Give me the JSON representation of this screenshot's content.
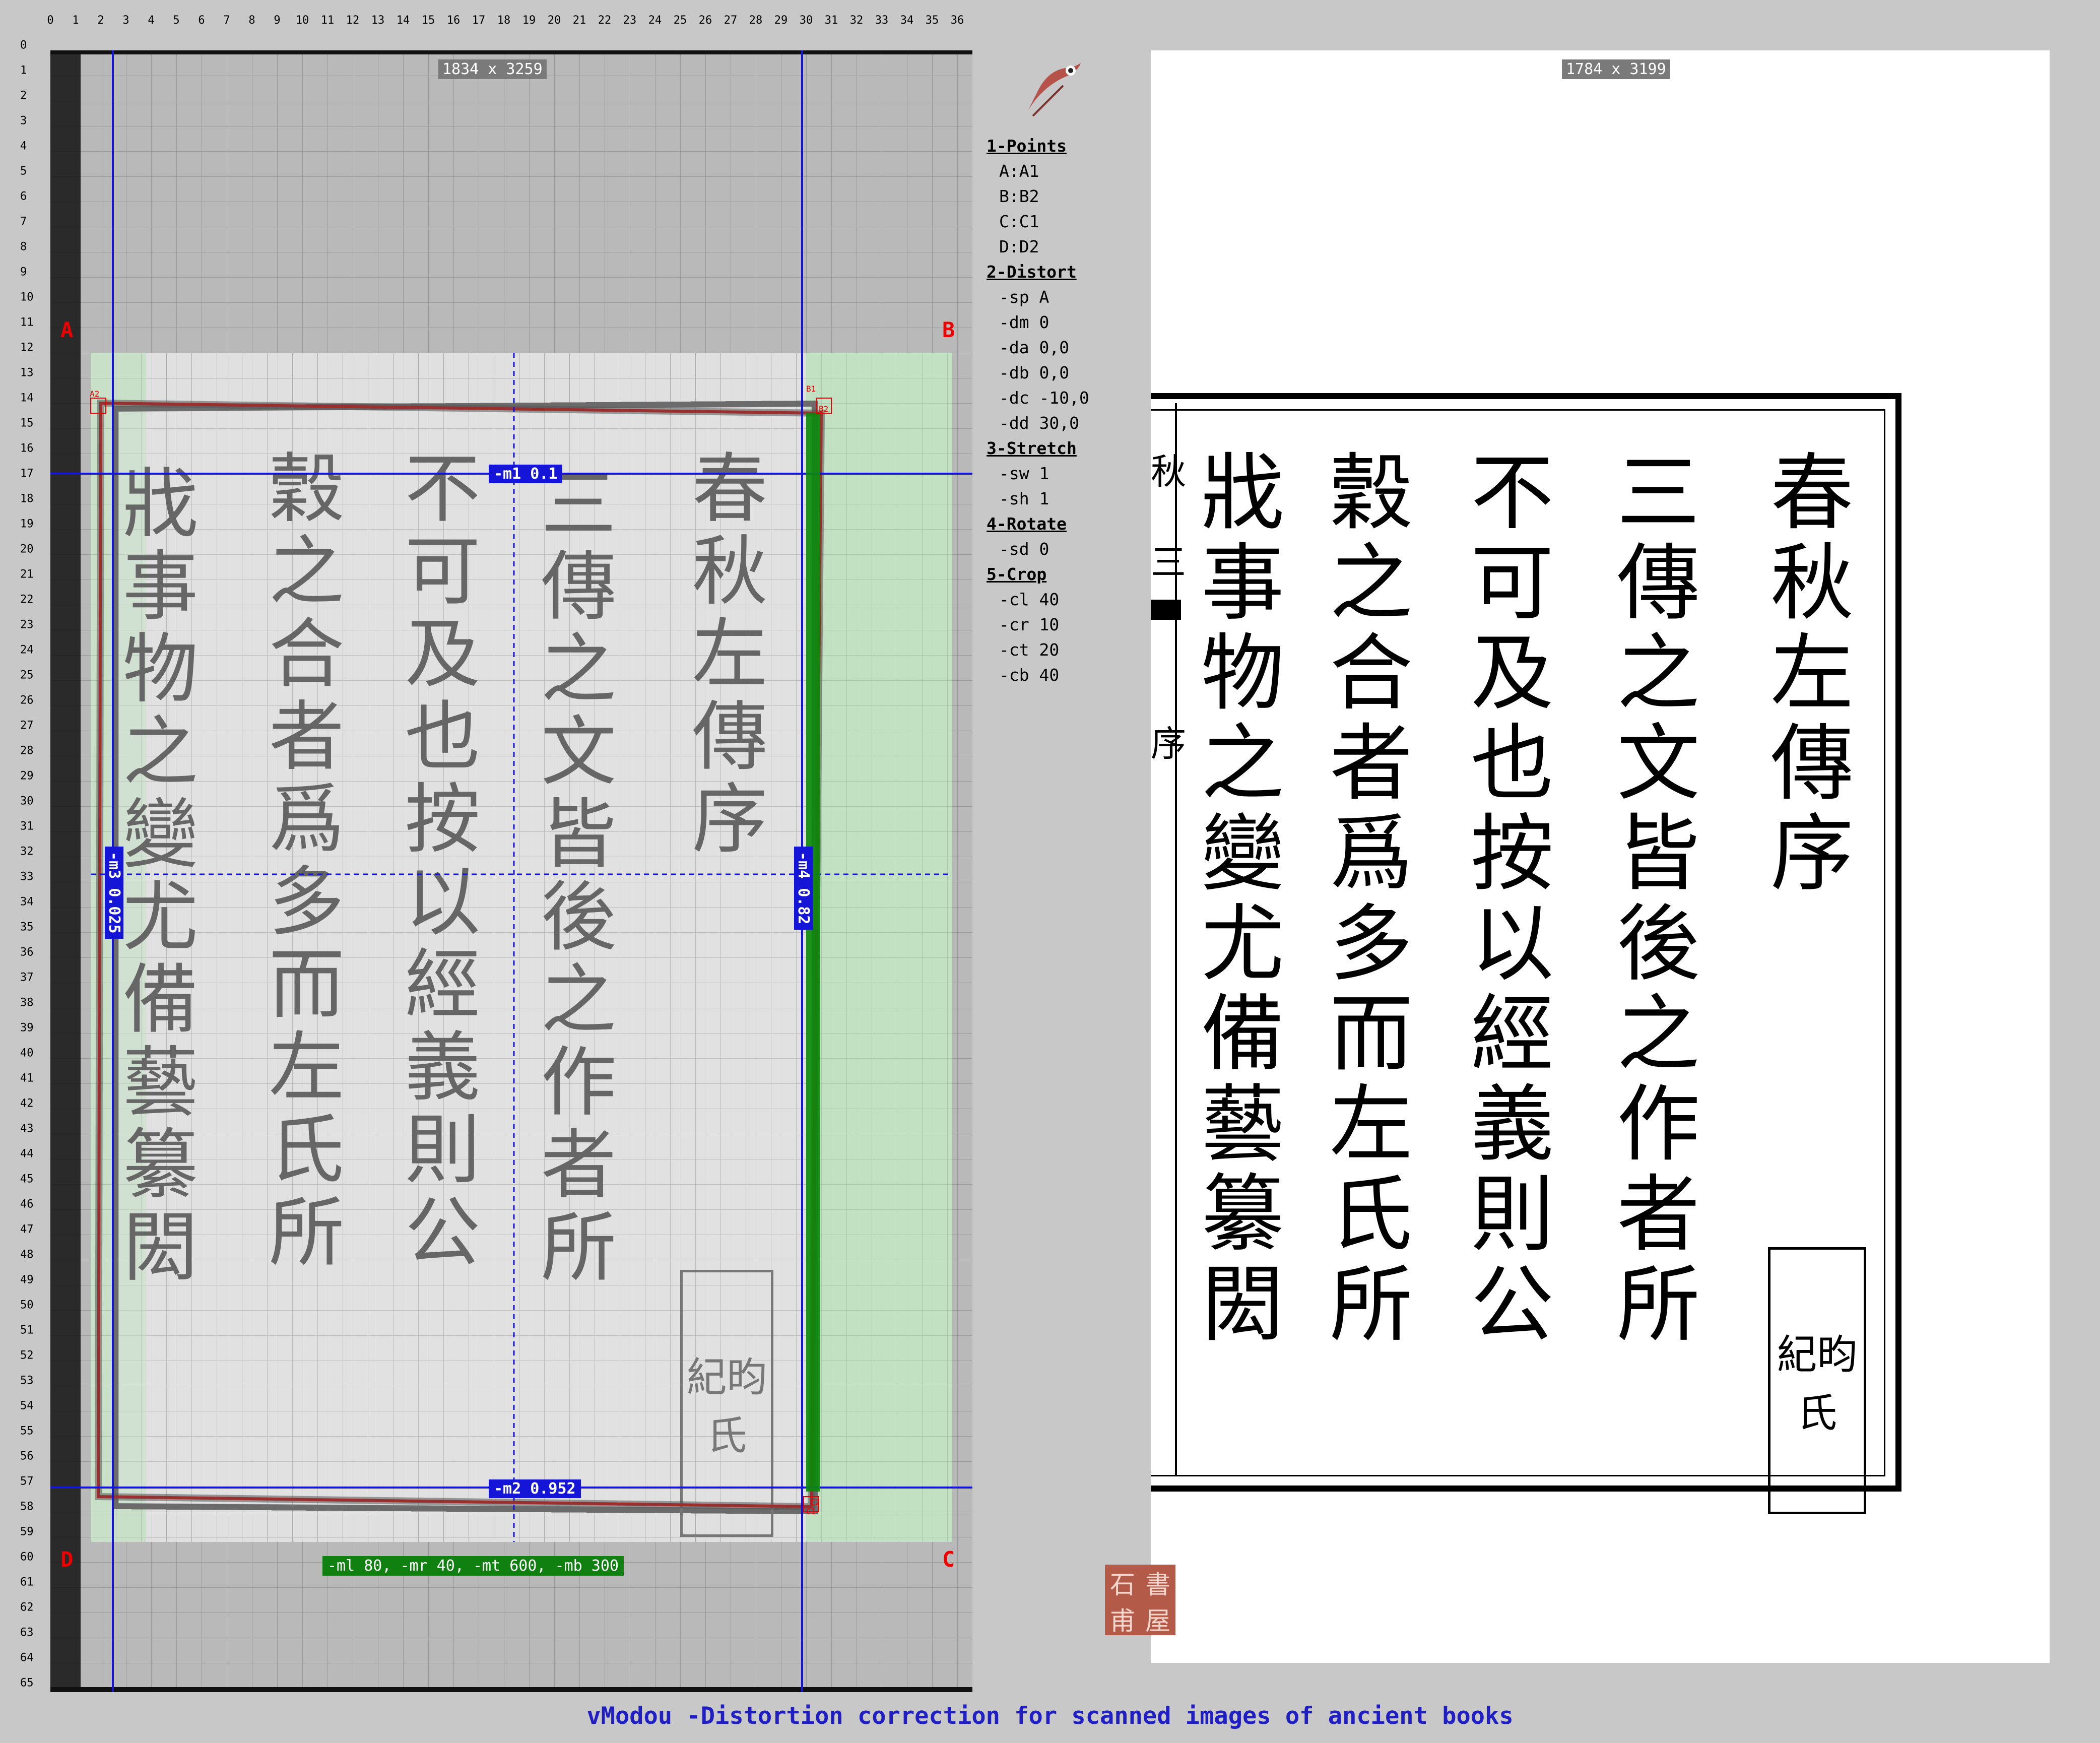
{
  "app": {
    "footer_title": "vModou -Distortion correction for scanned images of ancient books"
  },
  "ruler": {
    "top": [
      "0",
      "1",
      "2",
      "3",
      "4",
      "5",
      "6",
      "7",
      "8",
      "9",
      "10",
      "11",
      "12",
      "13",
      "14",
      "15",
      "16",
      "17",
      "18",
      "19",
      "20",
      "21",
      "22",
      "23",
      "24",
      "25",
      "26",
      "27",
      "28",
      "29",
      "30",
      "31",
      "32",
      "33",
      "34",
      "35",
      "36"
    ],
    "left": [
      "0",
      "1",
      "2",
      "3",
      "4",
      "5",
      "6",
      "7",
      "8",
      "9",
      "10",
      "11",
      "12",
      "13",
      "14",
      "15",
      "16",
      "17",
      "18",
      "19",
      "20",
      "21",
      "22",
      "23",
      "24",
      "25",
      "26",
      "27",
      "28",
      "29",
      "30",
      "31",
      "32",
      "33",
      "34",
      "35",
      "36",
      "37",
      "38",
      "39",
      "40",
      "41",
      "42",
      "43",
      "44",
      "45",
      "46",
      "47",
      "48",
      "49",
      "50",
      "51",
      "52",
      "53",
      "54",
      "55",
      "56",
      "57",
      "58",
      "59",
      "60",
      "61",
      "62",
      "63",
      "64",
      "65"
    ]
  },
  "left_panel": {
    "dimensions": "1834 x 3259",
    "corners": {
      "a": "A",
      "b": "B",
      "c": "C",
      "d": "D"
    },
    "point_labels": {
      "a1": "A1",
      "a2": "A2",
      "b1": "B1",
      "b2": "B2",
      "c1": "C1",
      "c2": "C2"
    },
    "guides": {
      "m1": "-m1 0.1",
      "m2": "-m2 0.952",
      "m3": "-m3 0.025",
      "m4": "-m4 0.82"
    },
    "margins": "-ml 80, -mr 40, -mt 600, -mb 300"
  },
  "text_columns": [
    "春秋左傳序",
    "三傳之文皆後之作者所",
    "不可及也按以經義則公",
    "穀之合者爲多而左氏所",
    "戕事物之變尤備藝纂閎"
  ],
  "seal_text": [
    "紀",
    "昀",
    "氏"
  ],
  "sidebar": {
    "sections": [
      {
        "title": "1-Points",
        "items": [
          "A:A1",
          "B:B2",
          "C:C1",
          "D:D2"
        ]
      },
      {
        "title": "2-Distort",
        "items": [
          "-sp A",
          "-dm 0",
          "-da 0,0",
          "-db 0,0",
          "-dc -10,0",
          "-dd 30,0"
        ]
      },
      {
        "title": "3-Stretch",
        "items": [
          "-sw 1",
          "-sh 1"
        ]
      },
      {
        "title": "4-Rotate",
        "items": [
          "-sd 0"
        ]
      },
      {
        "title": "5-Crop",
        "items": [
          "-cl 40",
          "-cr 10",
          "-ct 20",
          "-cb 40"
        ]
      }
    ]
  },
  "right_panel": {
    "dimensions": "1784 x 3199",
    "edge_chars": [
      "秋",
      "三",
      "序"
    ]
  },
  "bottom_stamp": [
    "石",
    "書",
    "甫",
    "屋"
  ],
  "colors": {
    "guide_blue": "#1515d8",
    "corner_red": "#e00000",
    "margin_green": "#108010",
    "footer_blue": "#1f1fc4",
    "stamp_red": "#b45a48"
  }
}
